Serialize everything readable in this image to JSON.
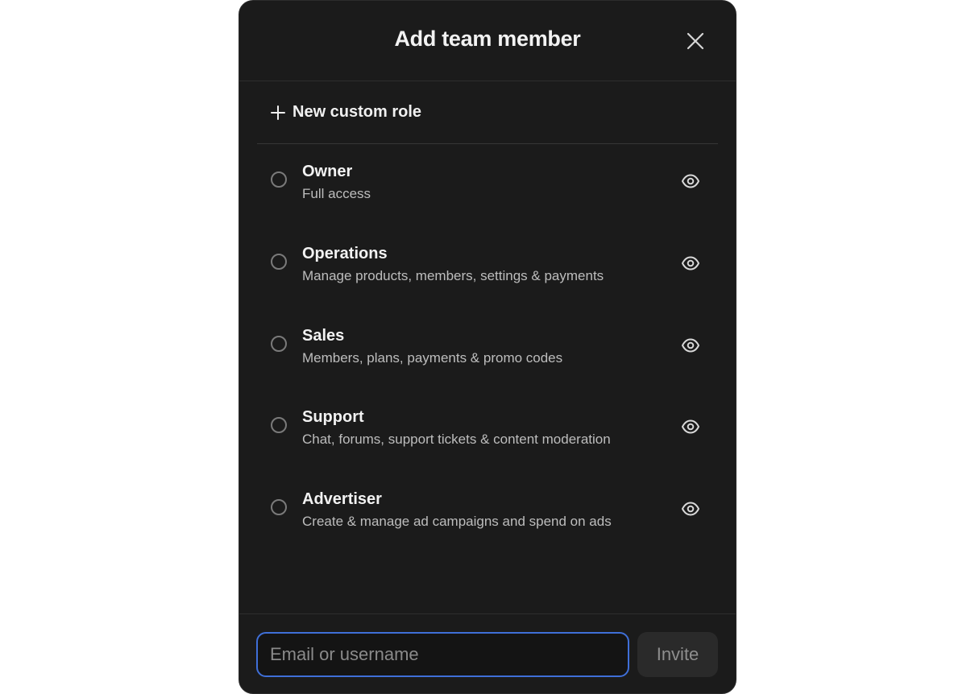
{
  "dialog": {
    "title": "Add team member"
  },
  "custom_role": {
    "label": "New custom role"
  },
  "roles": [
    {
      "name": "Owner",
      "description": "Full access"
    },
    {
      "name": "Operations",
      "description": "Manage products, members, settings & payments"
    },
    {
      "name": "Sales",
      "description": "Members, plans, payments & promo codes"
    },
    {
      "name": "Support",
      "description": "Chat, forums, support tickets & content moderation"
    },
    {
      "name": "Advertiser",
      "description": "Create & manage ad campaigns and spend on ads"
    }
  ],
  "footer": {
    "email_placeholder": "Email or username",
    "email_value": "",
    "invite_label": "Invite"
  },
  "colors": {
    "modal_background": "#1b1b1b",
    "input_focus_border": "#3f6fd8",
    "invite_button_background": "#2a2a2a"
  },
  "icons": {
    "close": "close-icon",
    "add": "plus-icon",
    "view": "eye-icon",
    "select": "radio-icon"
  }
}
